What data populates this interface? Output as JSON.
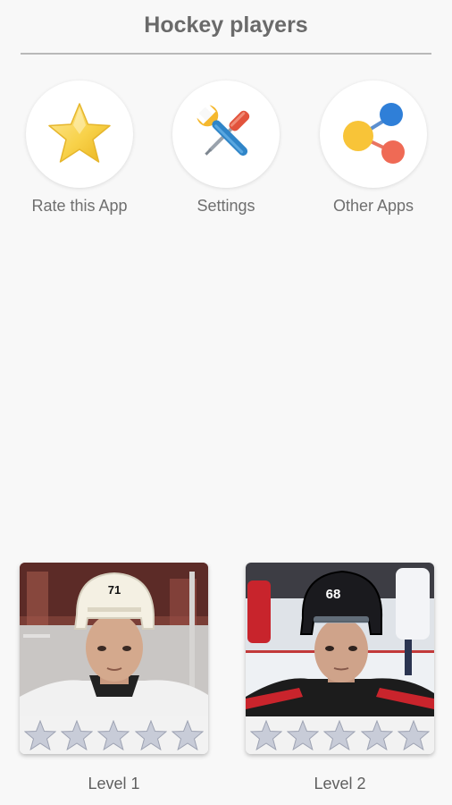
{
  "header": {
    "title": "Hockey players"
  },
  "actions": [
    {
      "label": "Rate this App",
      "icon": "star-icon"
    },
    {
      "label": "Settings",
      "icon": "tools-icon"
    },
    {
      "label": "Other Apps",
      "icon": "share-icon"
    }
  ],
  "levels": [
    {
      "label": "Level 1",
      "stars_filled": 0,
      "stars_total": 5,
      "jersey_number": "71"
    },
    {
      "label": "Level 2",
      "stars_filled": 0,
      "stars_total": 5,
      "jersey_number": "68"
    }
  ],
  "colors": {
    "background": "#f8f8f8",
    "title": "#6a6a6a",
    "star_empty": "#c8ccd8",
    "star_gold": "#f7cc3c"
  }
}
